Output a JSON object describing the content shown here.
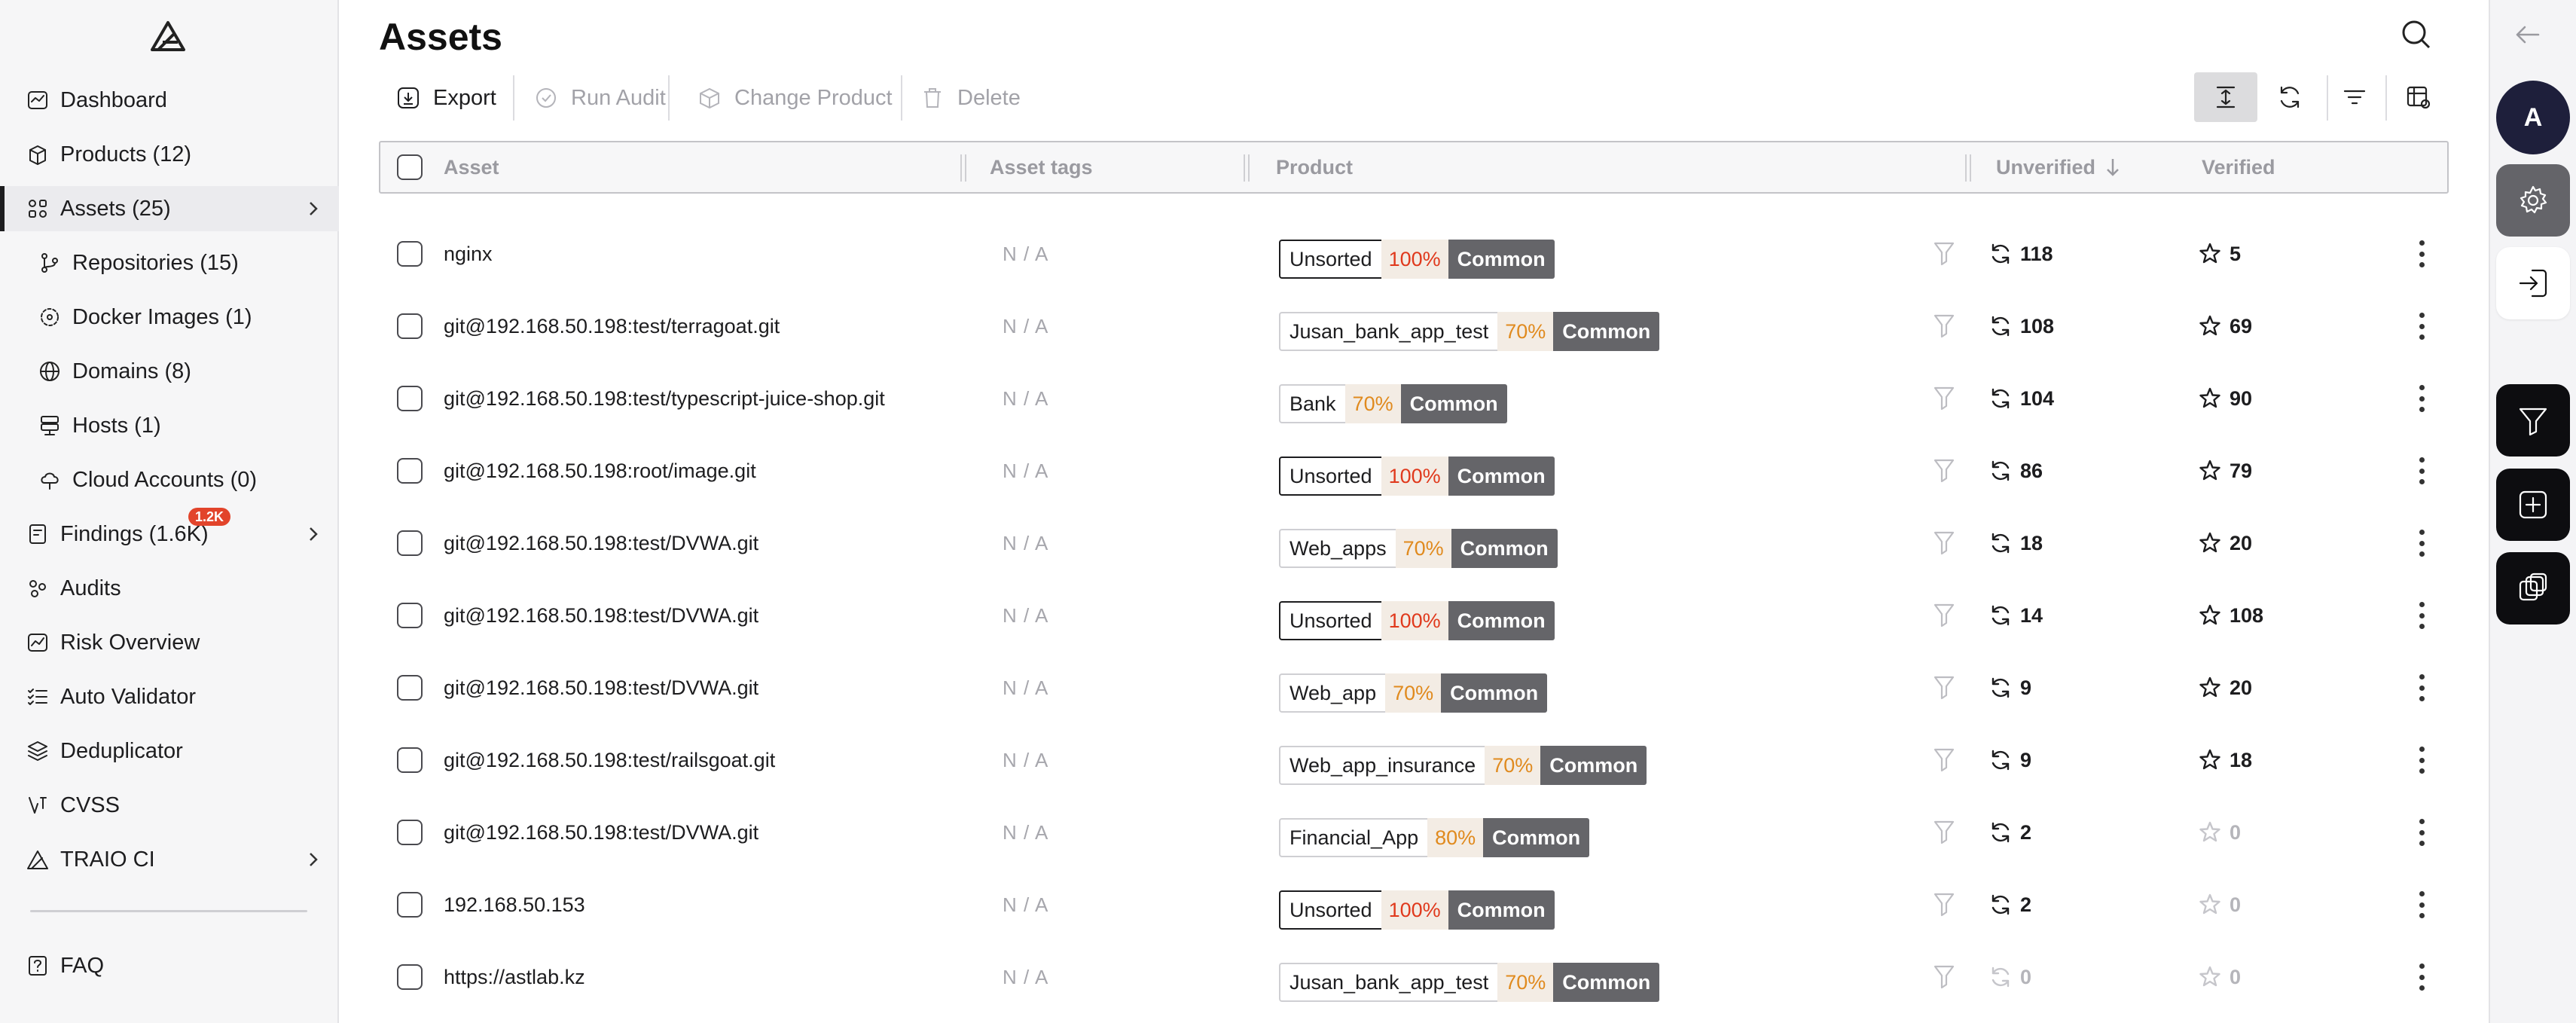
{
  "sidebar": {
    "items": [
      {
        "label": "Dashboard",
        "icon": "dashboard-icon"
      },
      {
        "label": "Products (12)",
        "icon": "products-icon"
      },
      {
        "label": "Assets (25)",
        "icon": "assets-icon",
        "active": true
      },
      {
        "label": "Repositories (15)",
        "icon": "repository-icon"
      },
      {
        "label": "Docker Images (1)",
        "icon": "docker-icon"
      },
      {
        "label": "Domains (8)",
        "icon": "globe-icon"
      },
      {
        "label": "Hosts (1)",
        "icon": "server-icon"
      },
      {
        "label": "Cloud Accounts (0)",
        "icon": "cloud-icon"
      },
      {
        "label": "Findings (1.6K)",
        "icon": "findings-icon",
        "badge": "1.2K"
      },
      {
        "label": "Audits",
        "icon": "audits-icon"
      },
      {
        "label": "Risk Overview",
        "icon": "risk-chart-icon"
      },
      {
        "label": "Auto Validator",
        "icon": "checklist-icon"
      },
      {
        "label": "Deduplicator",
        "icon": "stack-icon"
      },
      {
        "label": "CVSS",
        "icon": "cvss-icon"
      },
      {
        "label": "TRAIO CI",
        "icon": "traio-logo-icon"
      },
      {
        "label": "FAQ",
        "icon": "faq-icon"
      }
    ]
  },
  "header": {
    "title": "Assets"
  },
  "toolbar": {
    "export": "Export",
    "run_audit": "Run Audit",
    "change_product": "Change Product",
    "delete": "Delete"
  },
  "table": {
    "columns": {
      "asset": "Asset",
      "asset_tags": "Asset tags",
      "product": "Product",
      "unverified": "Unverified",
      "verified": "Verified"
    },
    "rows": [
      {
        "asset": "nginx",
        "tags": "N / A",
        "product": "Unsorted",
        "pct": "100%",
        "common": "Common",
        "unverified": "118",
        "verified": "5"
      },
      {
        "asset": "git@192.168.50.198:test/terragoat.git",
        "tags": "N / A",
        "product": "Jusan_bank_app_test",
        "pct": "70%",
        "common": "Common",
        "unverified": "108",
        "verified": "69"
      },
      {
        "asset": "git@192.168.50.198:test/typescript-juice-shop.git",
        "tags": "N / A",
        "product": "Bank",
        "pct": "70%",
        "common": "Common",
        "unverified": "104",
        "verified": "90"
      },
      {
        "asset": "git@192.168.50.198:root/image.git",
        "tags": "N / A",
        "product": "Unsorted",
        "pct": "100%",
        "common": "Common",
        "unverified": "86",
        "verified": "79"
      },
      {
        "asset": "git@192.168.50.198:test/DVWA.git",
        "tags": "N / A",
        "product": "Web_apps",
        "pct": "70%",
        "common": "Common",
        "unverified": "18",
        "verified": "20"
      },
      {
        "asset": "git@192.168.50.198:test/DVWA.git",
        "tags": "N / A",
        "product": "Unsorted",
        "pct": "100%",
        "common": "Common",
        "unverified": "14",
        "verified": "108"
      },
      {
        "asset": "git@192.168.50.198:test/DVWA.git",
        "tags": "N / A",
        "product": "Web_app",
        "pct": "70%",
        "common": "Common",
        "unverified": "9",
        "verified": "20"
      },
      {
        "asset": "git@192.168.50.198:test/railsgoat.git",
        "tags": "N / A",
        "product": "Web_app_insurance",
        "pct": "70%",
        "common": "Common",
        "unverified": "9",
        "verified": "18"
      },
      {
        "asset": "git@192.168.50.198:test/DVWA.git",
        "tags": "N / A",
        "product": "Financial_App",
        "pct": "80%",
        "common": "Common",
        "unverified": "2",
        "verified": "0"
      },
      {
        "asset": "192.168.50.153",
        "tags": "N / A",
        "product": "Unsorted",
        "pct": "100%",
        "common": "Common",
        "unverified": "2",
        "verified": "0"
      },
      {
        "asset": "https://astlab.kz",
        "tags": "N / A",
        "product": "Jusan_bank_app_test",
        "pct": "70%",
        "common": "Common",
        "unverified": "0",
        "verified": "0"
      }
    ]
  },
  "right_rail": {
    "avatar_initial": "A"
  },
  "colors": {
    "pct_100": "#e0391c",
    "pct_70": "#e08a1e",
    "common_bg": "#656569",
    "avatar_bg": "#1e1f3b",
    "badge": "#e2442b"
  }
}
